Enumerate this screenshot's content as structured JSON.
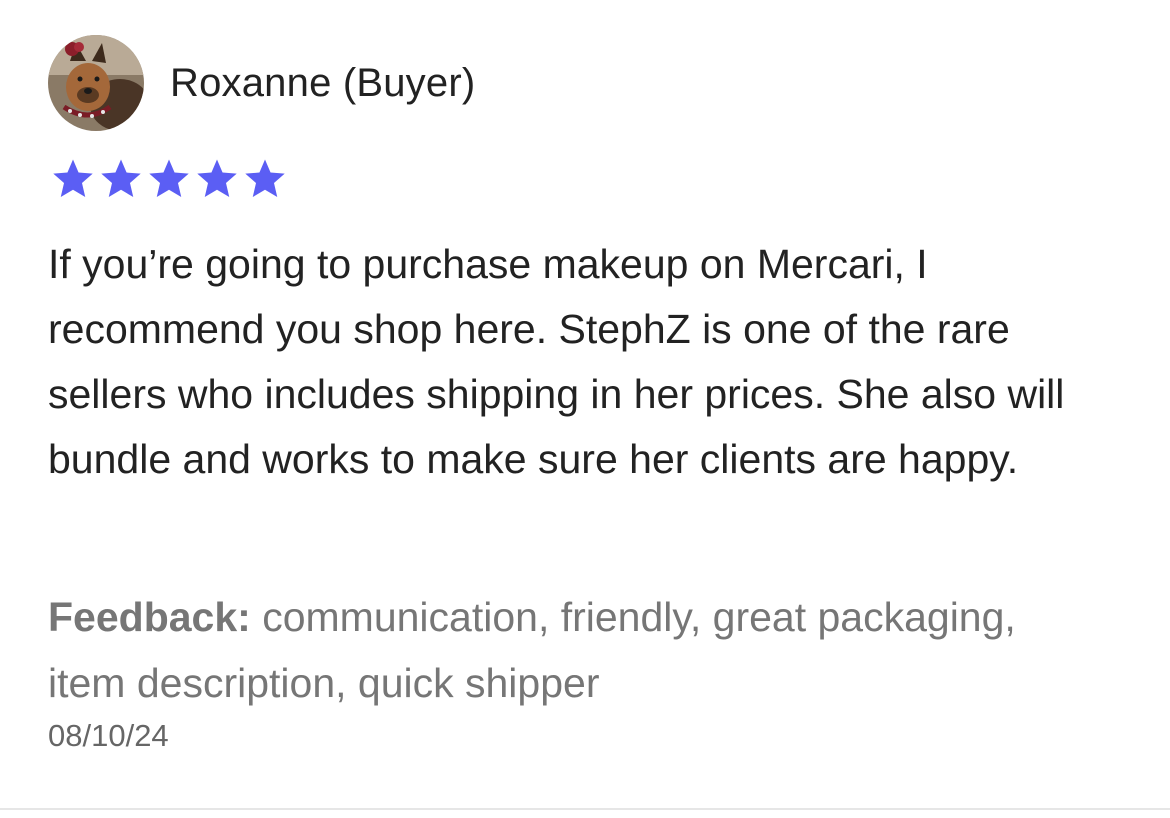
{
  "review": {
    "reviewer_name": "Roxanne (Buyer)",
    "avatar_icon": "dog-photo-avatar",
    "rating": 5,
    "rating_max": 5,
    "star_color": "#5b5ef4",
    "text": "If you’re going to purchase makeup on Mercari, I recommend you shop here. StephZ is one of the rare sellers who includes shipping in her prices. She also will bundle and works to make sure her clients are happy.",
    "feedback_label": "Feedback:",
    "feedback_tags": "communication, friendly, great packaging, item description, quick shipper",
    "date": "08/10/24"
  }
}
